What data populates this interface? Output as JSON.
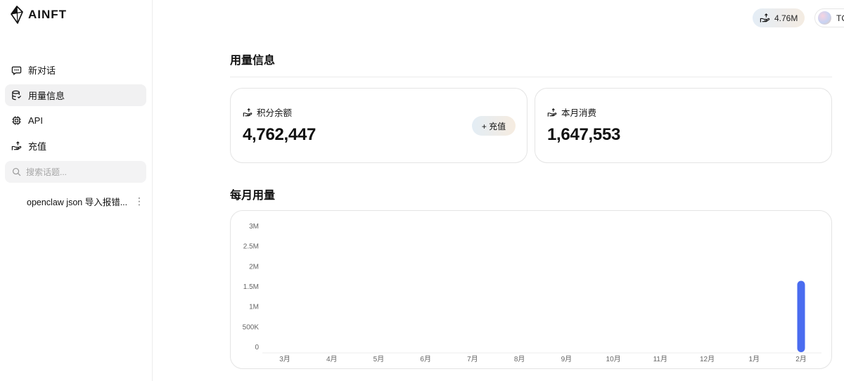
{
  "brand": {
    "name": "AINFT"
  },
  "sidebar": {
    "items": [
      {
        "label": "新对话",
        "icon": "chat-bubble-icon",
        "active": false
      },
      {
        "label": "用量信息",
        "icon": "database-icon",
        "active": true
      },
      {
        "label": "API",
        "icon": "chip-icon",
        "active": false
      },
      {
        "label": "充值",
        "icon": "topup-icon",
        "active": false
      }
    ],
    "search_placeholder": "搜索话题...",
    "conversations": [
      {
        "title": "openclaw json 导入报错..."
      }
    ]
  },
  "header": {
    "balance": "4.76M",
    "user_label": "TC"
  },
  "main": {
    "title": "用量信息",
    "cards": [
      {
        "label": "积分余额",
        "value": "4,762,447",
        "action": "+ 充值"
      },
      {
        "label": "本月消费",
        "value": "1,647,553"
      }
    ],
    "chart_title": "每月用量"
  },
  "chart_data": {
    "type": "bar",
    "title": "每月用量",
    "categories": [
      "3月",
      "4月",
      "5月",
      "6月",
      "7月",
      "8月",
      "9月",
      "10月",
      "11月",
      "12月",
      "1月",
      "2月"
    ],
    "values": [
      0,
      0,
      0,
      0,
      0,
      0,
      0,
      0,
      0,
      0,
      0,
      1647553
    ],
    "y_ticks": [
      {
        "value": 0,
        "label": "0"
      },
      {
        "value": 500000,
        "label": "500K"
      },
      {
        "value": 1000000,
        "label": "1M"
      },
      {
        "value": 1500000,
        "label": "1.5M"
      },
      {
        "value": 2000000,
        "label": "2M"
      },
      {
        "value": 2500000,
        "label": "2.5M"
      },
      {
        "value": 3000000,
        "label": "3M"
      }
    ],
    "ylim": [
      0,
      3000000
    ],
    "grid": false,
    "bar_color": "#4a6cf0"
  }
}
